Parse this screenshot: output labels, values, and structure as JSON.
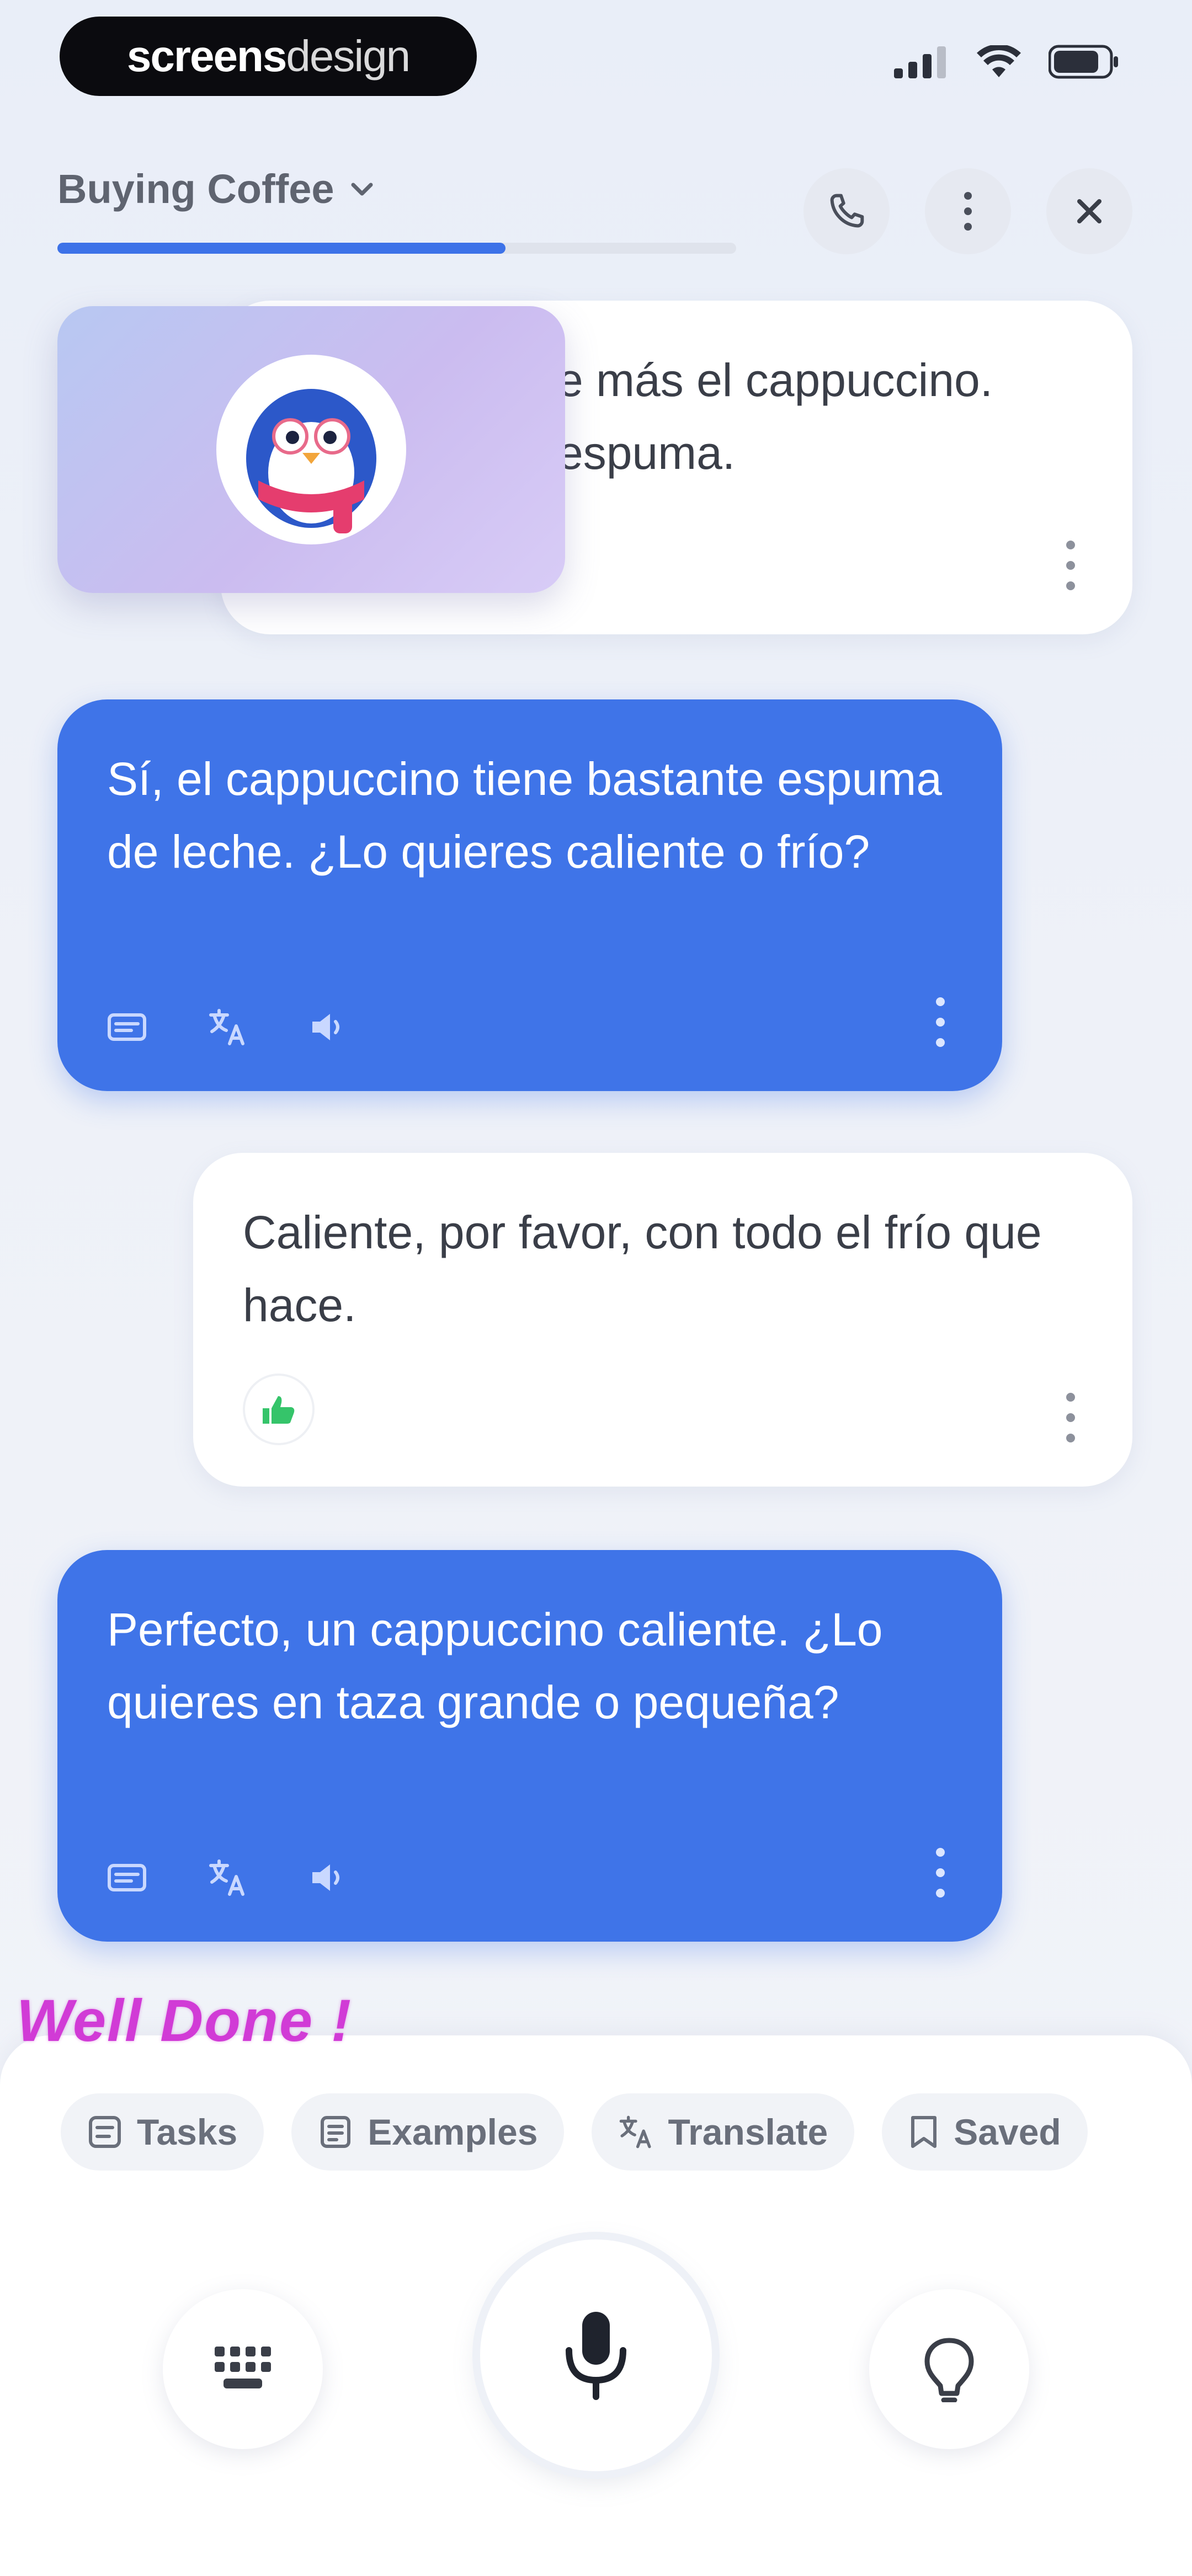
{
  "status_bar": {
    "brand_bold": "screens",
    "brand_light": "design",
    "icons": [
      "cellular-signal-icon",
      "wifi-icon",
      "battery-icon"
    ]
  },
  "header": {
    "title": "Buying Coffee",
    "progress": 0.66,
    "buttons": [
      "phone-icon",
      "more-vertical-icon",
      "close-icon"
    ]
  },
  "avatar": {
    "character": "penguin-mascot"
  },
  "messages": [
    {
      "role": "user",
      "text": "e más el cappuccino.\nespuma.",
      "partial": true
    },
    {
      "role": "ai",
      "text": "Sí, el cappuccino tiene bastante espuma de leche. ¿Lo quieres caliente o frío?",
      "tools": [
        "transcript-icon",
        "translate-icon",
        "speaker-icon"
      ]
    },
    {
      "role": "user",
      "text": "Caliente, por favor, con todo el frío que hace.",
      "feedback": "thumbs-up-icon"
    },
    {
      "role": "ai",
      "text": "Perfecto, un cappuccino caliente. ¿Lo quieres en taza grande o pequeña?",
      "tools": [
        "transcript-icon",
        "translate-icon",
        "speaker-icon"
      ]
    }
  ],
  "overlay": {
    "well_done": "Well Done !"
  },
  "chips": [
    {
      "label": "Tasks",
      "icon": "tasks-icon"
    },
    {
      "label": "Examples",
      "icon": "examples-icon"
    },
    {
      "label": "Translate",
      "icon": "translate-icon"
    },
    {
      "label": "Saved",
      "icon": "bookmark-icon"
    }
  ],
  "controls": {
    "left": "keyboard-icon",
    "center": "microphone-icon",
    "right": "hint-icon"
  },
  "colors": {
    "accent": "#3f74e8",
    "well_done": "#d13bd6",
    "feedback_green": "#35c46a"
  }
}
